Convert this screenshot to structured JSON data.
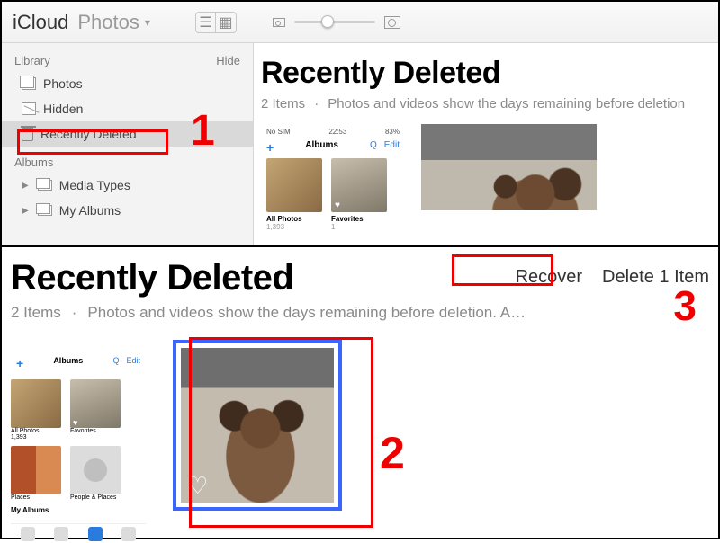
{
  "titlebar": {
    "app": "iCloud",
    "section": "Photos"
  },
  "sidebar": {
    "library_label": "Library",
    "hide_label": "Hide",
    "albums_label": "Albums",
    "items": [
      {
        "label": "Photos"
      },
      {
        "label": "Hidden"
      },
      {
        "label": "Recently Deleted"
      }
    ],
    "album_items": [
      {
        "label": "Media Types"
      },
      {
        "label": "My Albums"
      }
    ]
  },
  "main_top": {
    "heading": "Recently Deleted",
    "count_text": "2 Items",
    "dot": "·",
    "description": "Photos and videos show the days remaining before deletion",
    "phone": {
      "status_left": "No SIM",
      "status_time": "22:53",
      "status_right": "83%",
      "plus": "+",
      "title": "Albums",
      "search": "Q",
      "edit": "Edit",
      "cells": [
        {
          "label": "All Photos",
          "count": "1,393"
        },
        {
          "label": "Favorites",
          "count": "1"
        }
      ]
    }
  },
  "main_bottom": {
    "heading": "Recently Deleted",
    "recover": "Recover",
    "delete": "Delete 1 Item",
    "count_text": "2 Items",
    "dot": "·",
    "description": "Photos and videos show the days remaining before deletion. A…",
    "phone": {
      "title": "Albums",
      "search": "Q",
      "edit": "Edit",
      "cells_row1": [
        {
          "label": "All Photos",
          "count": "1,393"
        },
        {
          "label": "Favorites",
          "count": ""
        }
      ],
      "cells_row2": [
        {
          "label": "Places",
          "count": ""
        },
        {
          "label": "People & Places",
          "count": ""
        }
      ],
      "my_albums": "My Albums"
    }
  },
  "callouts": {
    "one": "1",
    "two": "2",
    "three": "3"
  }
}
